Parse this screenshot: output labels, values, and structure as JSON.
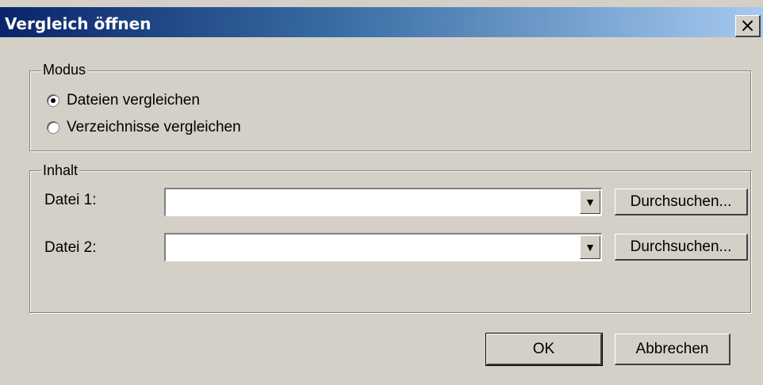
{
  "window": {
    "title": "Vergleich öffnen",
    "close_glyph": "×"
  },
  "modus": {
    "legend": "Modus",
    "options": [
      {
        "label": "Dateien vergleichen",
        "selected": true
      },
      {
        "label": "Verzeichnisse vergleichen",
        "selected": false
      }
    ]
  },
  "inhalt": {
    "legend": "Inhalt",
    "file1": {
      "label": "Datei 1:",
      "value": "",
      "browse": "Durchsuchen..."
    },
    "file2": {
      "label": "Datei 2:",
      "value": "",
      "browse": "Durchsuchen..."
    },
    "dropdown_icon": "▼"
  },
  "buttons": {
    "ok": "OK",
    "cancel": "Abbrechen"
  }
}
